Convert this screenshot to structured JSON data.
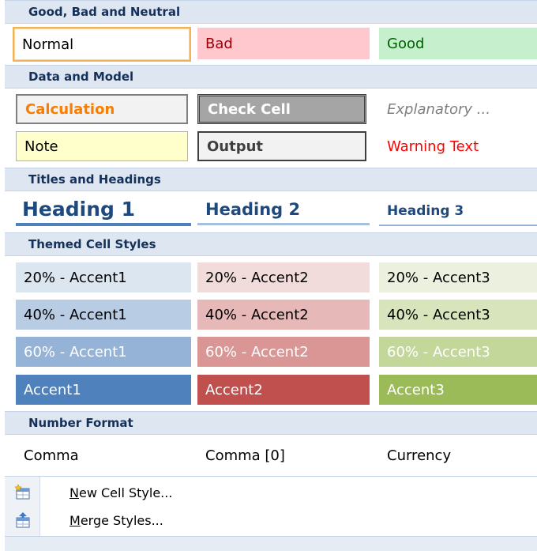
{
  "sections": {
    "good_bad_neutral": "Good, Bad and Neutral",
    "data_model": "Data and Model",
    "titles_headings": "Titles and Headings",
    "themed": "Themed Cell Styles",
    "number_format": "Number Format"
  },
  "styles": {
    "normal": "Normal",
    "bad": "Bad",
    "good": "Good",
    "calculation": "Calculation",
    "check_cell": "Check Cell",
    "explanatory": "Explanatory ...",
    "note": "Note",
    "output": "Output",
    "warning": "Warning Text",
    "heading1": "Heading 1",
    "heading2": "Heading 2",
    "heading3": "Heading 3",
    "a20_1": "20% - Accent1",
    "a20_2": "20% - Accent2",
    "a20_3": "20% - Accent3",
    "a40_1": "40% - Accent1",
    "a40_2": "40% - Accent2",
    "a40_3": "40% - Accent3",
    "a60_1": "60% - Accent1",
    "a60_2": "60% - Accent2",
    "a60_3": "60% - Accent3",
    "accent1": "Accent1",
    "accent2": "Accent2",
    "accent3": "Accent3",
    "comma": "Comma",
    "comma0": "Comma [0]",
    "currency": "Currency"
  },
  "menu": {
    "new_cell_style_hotkey": "N",
    "new_cell_style_rest": "ew Cell Style...",
    "merge_styles_hotkey": "M",
    "merge_styles_rest": "erge Styles..."
  },
  "icons": {
    "new_cell_style": "new-cell-style-icon",
    "merge_styles": "merge-styles-icon"
  },
  "colors": {
    "header_bg": "#dde6f1",
    "header_text": "#15315a",
    "bad_fill": "#ffc7ce",
    "bad_text": "#9c0006",
    "good_fill": "#c6efce",
    "good_text": "#006100",
    "accent1": "#4f81bd",
    "accent2": "#c0504d",
    "accent3": "#9bbb59"
  }
}
